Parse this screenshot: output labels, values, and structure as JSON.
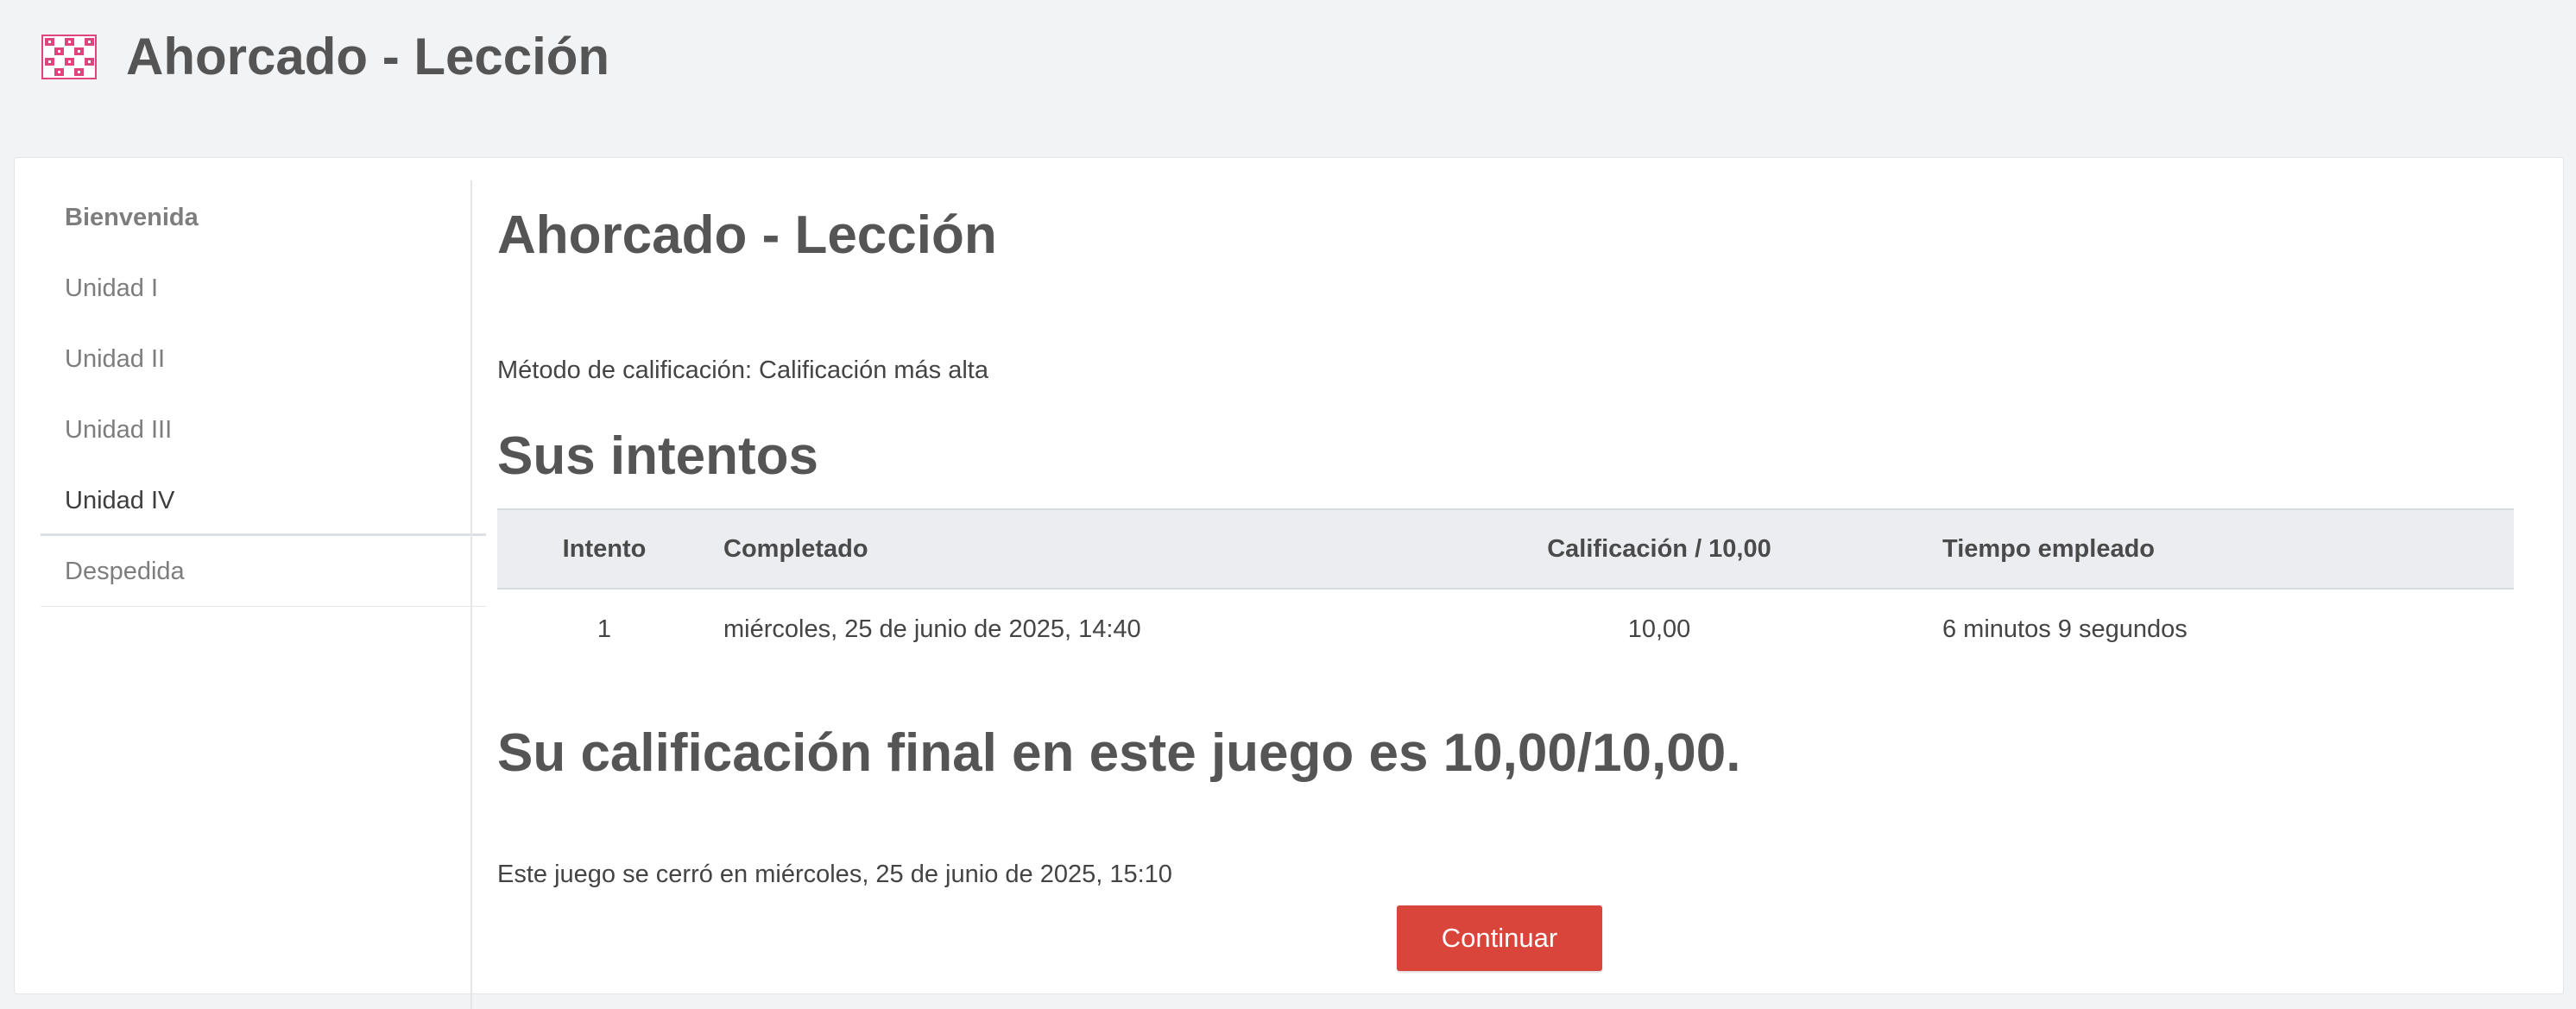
{
  "header": {
    "title": "Ahorcado - Lección",
    "icon": "hangman-game-icon",
    "icon_color": "#e0447f"
  },
  "sidebar": {
    "items": [
      {
        "label": "Bienvenida"
      },
      {
        "label": "Unidad I"
      },
      {
        "label": "Unidad II"
      },
      {
        "label": "Unidad III"
      },
      {
        "label": "Unidad IV"
      },
      {
        "label": "Despedida"
      }
    ]
  },
  "main": {
    "title": "Ahorcado - Lección",
    "grading_method": "Método de calificación: Calificación más alta",
    "attempts_heading": "Sus intentos",
    "table": {
      "headers": [
        "Intento",
        "Completado",
        "Calificación / 10,00",
        "Tiempo empleado"
      ],
      "rows": [
        [
          "1",
          "miércoles, 25 de junio de 2025, 14:40",
          "10,00",
          "6 minutos 9 segundos"
        ]
      ]
    },
    "final_grade": "Su calificación final en este juego es 10,00/10,00.",
    "closed_text": "Este juego se cerró en miércoles, 25 de junio de 2025, 15:10",
    "continue_label": "Continuar",
    "continue_color": "#d9453a"
  }
}
